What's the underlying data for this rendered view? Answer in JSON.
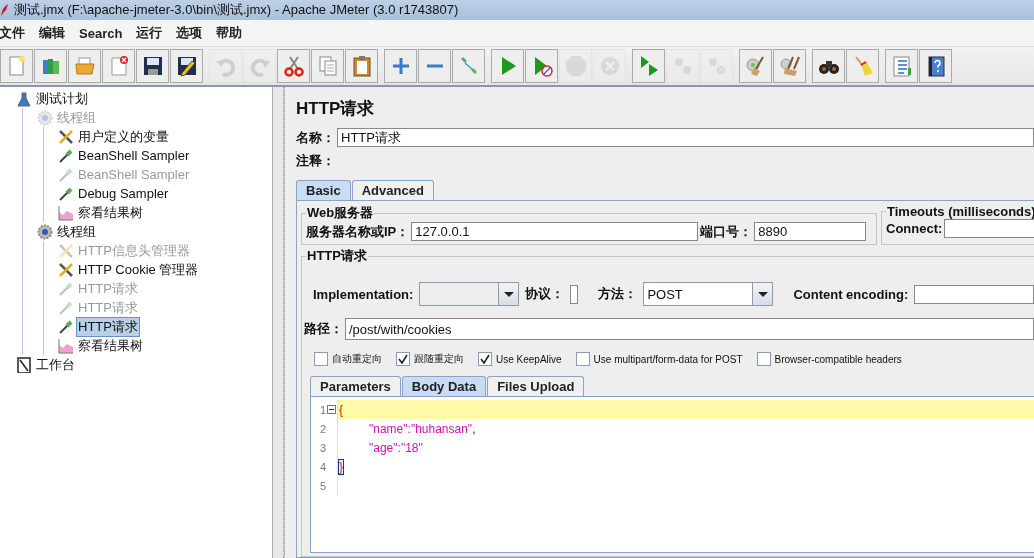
{
  "window": {
    "title": "测试.jmx (F:\\apache-jmeter-3.0\\bin\\测试.jmx) - Apache JMeter (3.0 r1743807)"
  },
  "menu": [
    "文件",
    "编辑",
    "Search",
    "运行",
    "选项",
    "帮助"
  ],
  "toolbar": [
    [
      {
        "kind": "new",
        "disabled": false
      },
      {
        "kind": "templates",
        "disabled": false
      },
      {
        "kind": "open",
        "disabled": false
      },
      {
        "kind": "close",
        "disabled": false
      },
      {
        "kind": "save",
        "disabled": false
      },
      {
        "kind": "saveas",
        "disabled": false
      }
    ],
    [
      {
        "kind": "undo",
        "disabled": true
      },
      {
        "kind": "redo",
        "disabled": true
      },
      {
        "kind": "cut",
        "disabled": false
      },
      {
        "kind": "copy",
        "disabled": false
      },
      {
        "kind": "paste",
        "disabled": false
      }
    ],
    [
      {
        "kind": "add",
        "disabled": false
      },
      {
        "kind": "remove",
        "disabled": false
      },
      {
        "kind": "toggle",
        "disabled": false
      }
    ],
    [
      {
        "kind": "start",
        "disabled": false
      },
      {
        "kind": "startnt",
        "disabled": false
      },
      {
        "kind": "stop",
        "disabled": true
      },
      {
        "kind": "shutdown",
        "disabled": true
      }
    ],
    [
      {
        "kind": "rstart",
        "disabled": false
      },
      {
        "kind": "rstop",
        "disabled": true
      },
      {
        "kind": "rshutdown",
        "disabled": true
      }
    ],
    [
      {
        "kind": "clear",
        "disabled": false
      },
      {
        "kind": "clearall",
        "disabled": false
      }
    ],
    [
      {
        "kind": "search",
        "disabled": false
      },
      {
        "kind": "reset",
        "disabled": false
      }
    ],
    [
      {
        "kind": "function",
        "disabled": false
      },
      {
        "kind": "help",
        "disabled": false
      }
    ]
  ],
  "tree": [
    {
      "label": "测试计划",
      "kind": "plan",
      "enabled": true,
      "selected": false,
      "children": [
        {
          "label": "线程组",
          "kind": "threadgroup",
          "enabled": false,
          "selected": false,
          "children": [
            {
              "label": "用户定义的变量",
              "kind": "config",
              "enabled": true,
              "selected": false
            },
            {
              "label": "BeanShell Sampler",
              "kind": "sampler",
              "enabled": true,
              "selected": false
            },
            {
              "label": "BeanShell Sampler",
              "kind": "sampler",
              "enabled": false,
              "selected": false
            },
            {
              "label": "Debug Sampler",
              "kind": "sampler",
              "enabled": true,
              "selected": false
            },
            {
              "label": "察看结果树",
              "kind": "listener",
              "enabled": true,
              "selected": false
            }
          ]
        },
        {
          "label": "线程组",
          "kind": "threadgroup",
          "enabled": true,
          "selected": false,
          "children": [
            {
              "label": "HTTP信息头管理器",
              "kind": "config",
              "enabled": false,
              "selected": false
            },
            {
              "label": "HTTP Cookie 管理器",
              "kind": "config",
              "enabled": true,
              "selected": false
            },
            {
              "label": "HTTP请求",
              "kind": "sampler",
              "enabled": false,
              "selected": false
            },
            {
              "label": "HTTP请求",
              "kind": "sampler",
              "enabled": false,
              "selected": false
            },
            {
              "label": "HTTP请求",
              "kind": "sampler",
              "enabled": true,
              "selected": true
            },
            {
              "label": "察看结果树",
              "kind": "listener",
              "enabled": true,
              "selected": false
            }
          ]
        }
      ]
    },
    {
      "label": "工作台",
      "kind": "workbench",
      "enabled": true,
      "selected": false
    }
  ],
  "panel": {
    "title": "HTTP请求",
    "name_label": "名称：",
    "name_value": "HTTP请求",
    "comment_label": "注释：",
    "tabs": [
      {
        "label": "Basic",
        "selected": true
      },
      {
        "label": "Advanced",
        "selected": false
      }
    ],
    "web_server": {
      "title": "Web服务器",
      "host_label": "服务器名称或IP：",
      "host_value": "127.0.0.1",
      "port_label": "端口号：",
      "port_value": "8890"
    },
    "timeouts": {
      "title": "Timeouts (milliseconds)",
      "connect_label": "Connect:"
    },
    "http_request": {
      "title": "HTTP请求",
      "implementation_label": "Implementation:",
      "protocol_label": "协议：",
      "method_label": "方法：",
      "method_value": "POST",
      "encoding_label": "Content encoding:",
      "path_label": "路径：",
      "path_value": "/post/with/cookies",
      "options": [
        {
          "label": "自动重定向",
          "checked": false
        },
        {
          "label": "跟随重定向",
          "checked": true
        },
        {
          "label": "Use KeepAlive",
          "checked": true
        },
        {
          "label": "Use multipart/form-data for POST",
          "checked": false
        },
        {
          "label": "Browser-compatible headers",
          "checked": false
        }
      ],
      "body_tabs": [
        {
          "label": "Parameters",
          "selected": false
        },
        {
          "label": "Body Data",
          "selected": true
        },
        {
          "label": "Files Upload",
          "selected": false
        }
      ],
      "editor": {
        "lines": [
          {
            "number": "1",
            "fold": true,
            "current": true,
            "cursor": false,
            "tokens": [
              {
                "text": "{",
                "kind": "brace"
              }
            ]
          },
          {
            "number": "2",
            "fold": false,
            "current": false,
            "cursor": false,
            "tokens": [
              {
                "text": "\t\"name\":\"huhansan\"",
                "kind": "string"
              },
              {
                "text": ",",
                "kind": "plain"
              }
            ]
          },
          {
            "number": "3",
            "fold": false,
            "current": false,
            "cursor": false,
            "tokens": [
              {
                "text": "\t\"age\":\"18\"",
                "kind": "string"
              }
            ]
          },
          {
            "number": "4",
            "fold": false,
            "current": false,
            "cursor": true,
            "tokens": [
              {
                "text": "}",
                "kind": "brace"
              }
            ]
          },
          {
            "number": "5",
            "fold": false,
            "current": false,
            "cursor": false
          }
        ]
      }
    }
  }
}
